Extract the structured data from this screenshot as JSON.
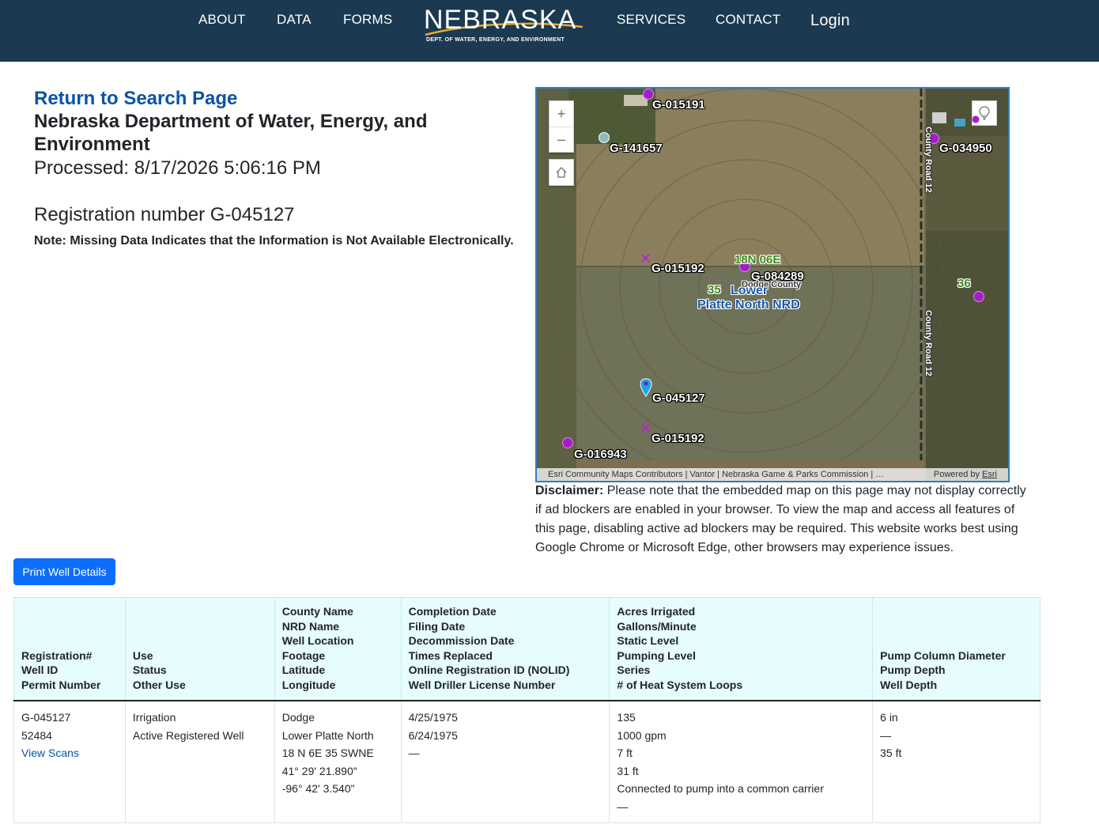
{
  "nav": {
    "about": "ABOUT",
    "data": "DATA",
    "forms": "FORMS",
    "services": "SERVICES",
    "contact": "CONTACT",
    "login": "Login"
  },
  "logo": {
    "word": "NEBRASKA",
    "subtitle": "DEPT. OF WATER, ENERGY, AND ENVIRONMENT"
  },
  "page": {
    "return_link": "Return to Search Page",
    "department": "Nebraska Department of Water, Energy, and Environment",
    "processed": "Processed: 8/17/2026 5:06:16 PM",
    "registration": "Registration number G-045127",
    "note": "Note: Missing Data Indicates that the Information is Not Available Electronically."
  },
  "map": {
    "labels": {
      "g015191": "G-015191",
      "g141657": "G-141657",
      "g034950": "G-034950",
      "g015192a": "G-015192",
      "g084289": "G-084289",
      "g045127": "G-045127",
      "g015192b": "G-015192",
      "g016943": "G-016943",
      "township": "18N 06E",
      "sec35": "35",
      "sec36": "36",
      "county": "Dodge County",
      "nrd_line1": "Lower",
      "nrd_line2": "Platte North NRD",
      "road1": "County Road 12",
      "road2": "County Road 12"
    },
    "zoom_in": "+",
    "zoom_out": "–",
    "attribution": "Esri Community Maps Contributors | Vantor | Nebraska Game & Parks Commission | …",
    "powered_by": "Powered by",
    "esri": "Esri",
    "colors": {
      "well_marker": "#a41ec6",
      "selected_marker": "#1aa3e8",
      "map_border": "#2f7fc1"
    }
  },
  "disclaimer": {
    "label": "Disclaimer:",
    "text": " Please note that the embedded map on this page may not display correctly if ad blockers are enabled in your browser. To view the map and access all features of this page, disabling active ad blockers may be required. This website works best using Google Chrome or Microsoft Edge, other browsers may experience issues."
  },
  "print_button": "Print Well Details",
  "table": {
    "headers": [
      [
        "Registration#",
        "Well ID",
        "Permit Number"
      ],
      [
        "Use",
        "Status",
        "Other Use"
      ],
      [
        "County Name",
        "NRD Name",
        "Well Location",
        "Footage",
        "Latitude",
        "Longitude"
      ],
      [
        "Completion Date",
        "Filing Date",
        "Decommission Date",
        "Times Replaced",
        "Online Registration ID (NOLID)",
        "Well Driller License Number"
      ],
      [
        "Acres Irrigated",
        "Gallons/Minute",
        "Static Level",
        "Pumping Level",
        "Series",
        "# of Heat System Loops"
      ],
      [
        "Pump Column Diameter",
        "Pump Depth",
        "Well Depth"
      ]
    ],
    "row": {
      "registration": "G-045127",
      "well_id": "52484",
      "view_scans": "View Scans",
      "use": "Irrigation",
      "status": "Active Registered Well",
      "county": "Dodge",
      "nrd": "Lower Platte North",
      "location": "18 N 6E 35 SWNE",
      "latitude": "41° 29' 21.890\"",
      "longitude": "-96° 42' 3.540\"",
      "completion_date": "4/25/1975",
      "filing_date": "6/24/1975",
      "decommission_date": "—",
      "acres": "135",
      "gpm": "1000 gpm",
      "static_level": "7 ft",
      "pumping_level": "31 ft",
      "series": "Connected to pump into a common carrier",
      "heat_loops": "—",
      "pump_column": "6 in",
      "pump_depth": "—",
      "well_depth": "35 ft"
    }
  }
}
